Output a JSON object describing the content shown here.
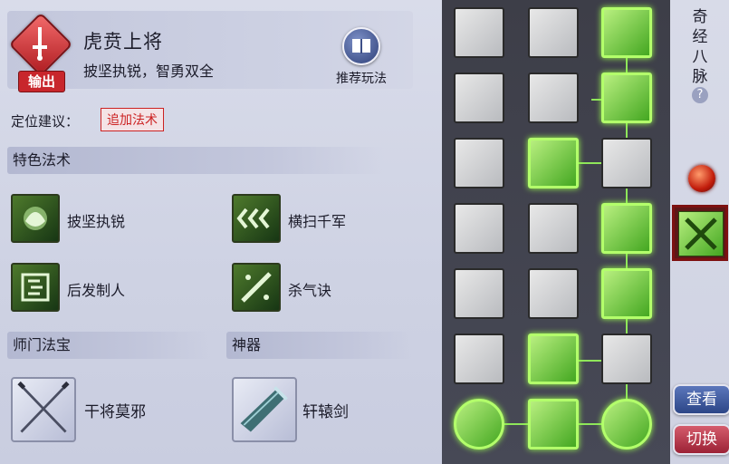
{
  "header": {
    "role_badge": "输出",
    "name": "虎贲上将",
    "motto": "披坚执锐，智勇双全",
    "recommend_button": "推荐玩法"
  },
  "positioning": {
    "label": "定位建议：",
    "add_button": "追加法术"
  },
  "special_skills": {
    "title": "特色法术",
    "items": [
      {
        "label": "披坚执锐",
        "icon": "armor-icon"
      },
      {
        "label": "横扫千军",
        "icon": "sweep-icon"
      },
      {
        "label": "后发制人",
        "icon": "counter-icon"
      },
      {
        "label": "杀气诀",
        "icon": "killing-aura-icon"
      }
    ]
  },
  "sect_treasure": {
    "title": "师门法宝",
    "item": "干将莫邪"
  },
  "artifact": {
    "title": "神器",
    "item": "轩辕剑"
  },
  "right_panel": {
    "meridian_label": "奇经八脉",
    "help": "?",
    "view_button": "查看",
    "switch_button": "切换"
  },
  "colors": {
    "active_node": "#7cd146",
    "grid_bg": "#434451",
    "view_button": "#3a56a0",
    "switch_button": "#b83447",
    "badge": "#c8262c"
  }
}
